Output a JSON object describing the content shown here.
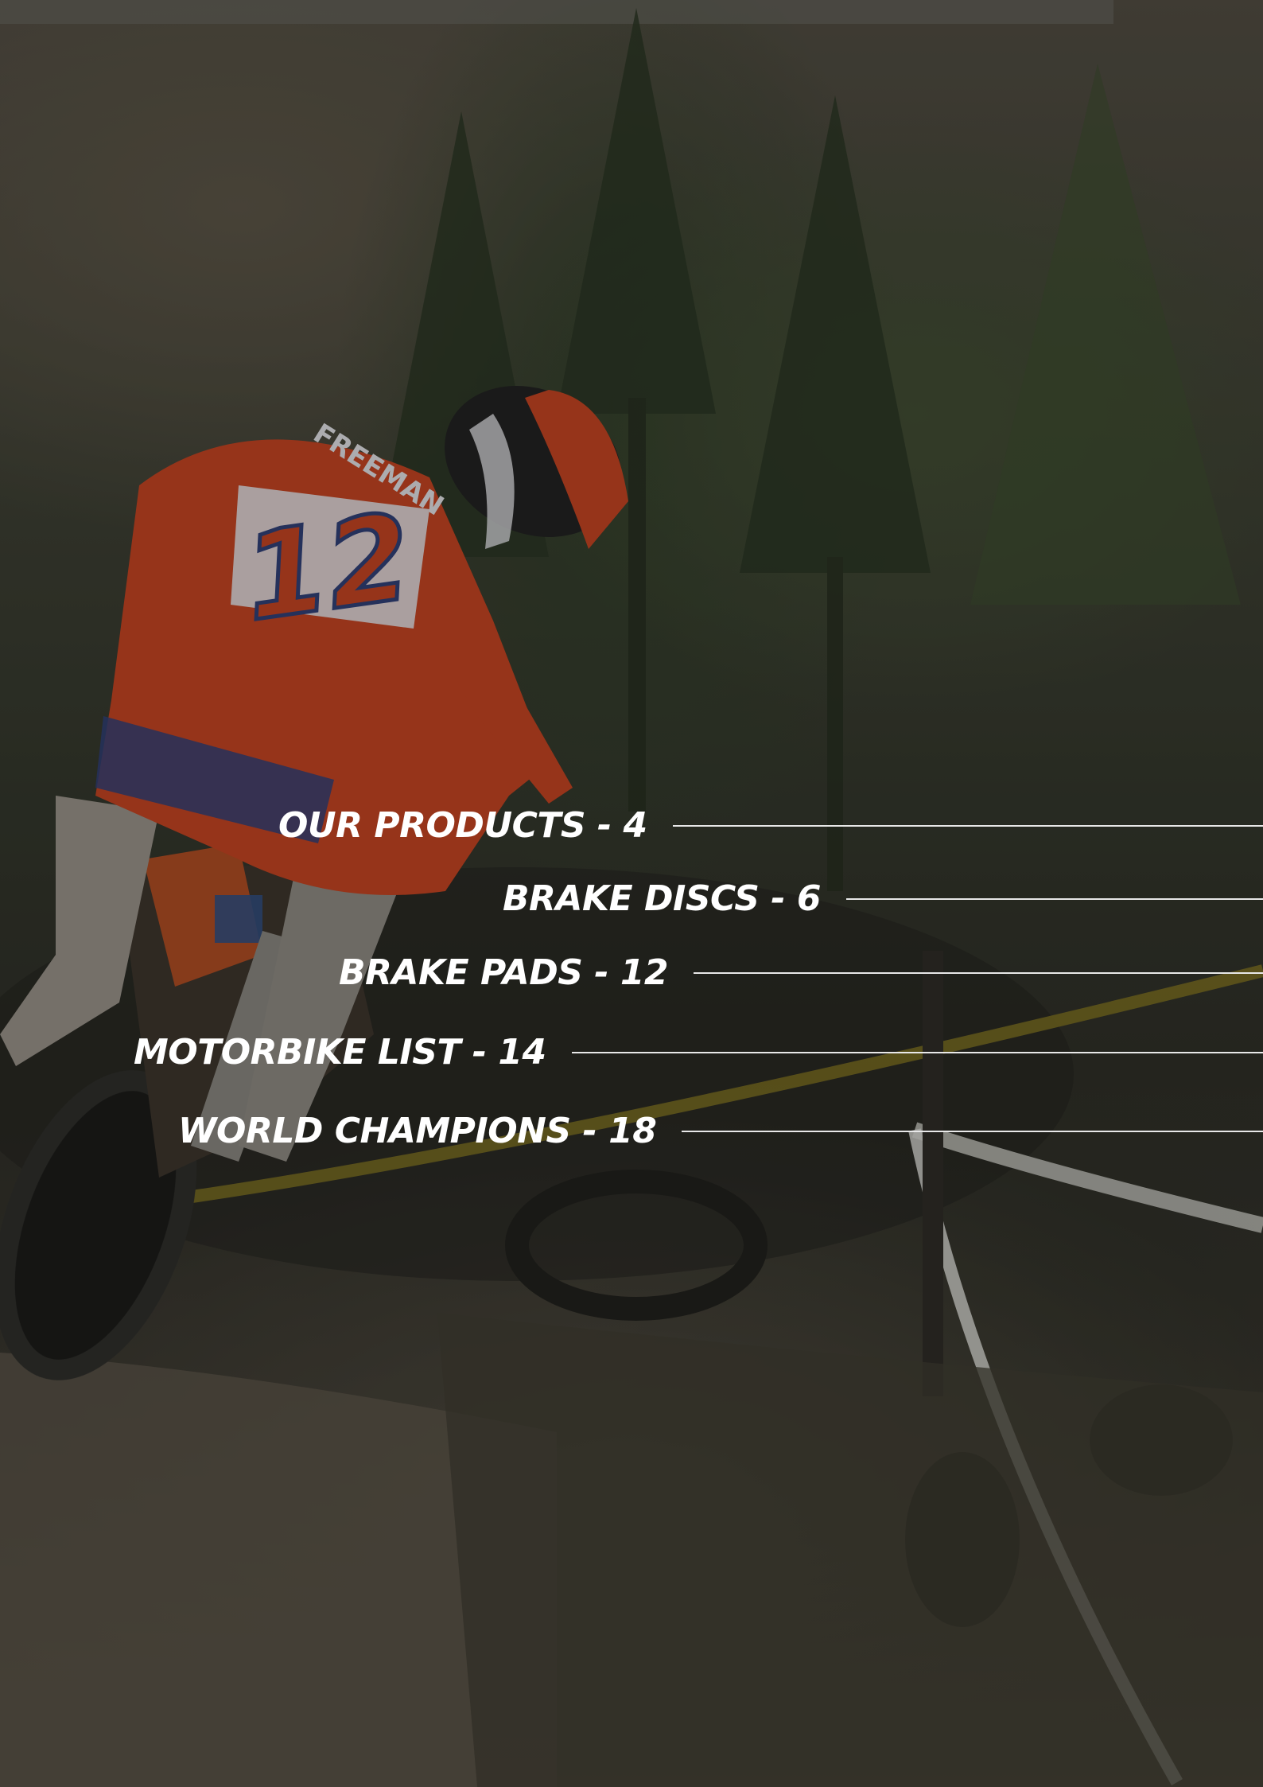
{
  "toc": {
    "entries": [
      {
        "label": "OUR PRODUCTS - 4"
      },
      {
        "label": "BRAKE DISCS - 6"
      },
      {
        "label": "BRAKE PADS - 12"
      },
      {
        "label": "MOTORBIKE LIST - 14"
      },
      {
        "label": "WORLD CHAMPIONS - 18"
      }
    ]
  },
  "photo": {
    "rider_number": "12",
    "rider_name": "FREEMAN"
  },
  "colors": {
    "text": "#ffffff",
    "divider": "#e8e8e8",
    "jersey": "#c8401c",
    "tape": "#8a7a1c"
  }
}
